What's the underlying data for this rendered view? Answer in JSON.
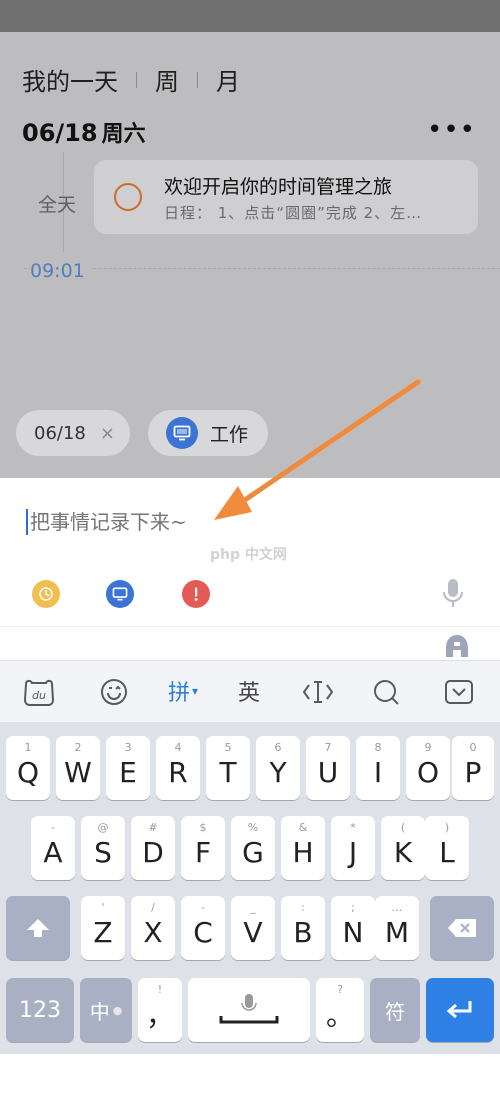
{
  "calendar": {
    "tabs": [
      "我的一天",
      "周",
      "月"
    ],
    "date": "06/18",
    "weekday": "周六",
    "more_label": "•••",
    "allday_label": "全天",
    "event": {
      "title": "欢迎开启你的时间管理之旅",
      "subtitle": "日程：  1、点击“圆圈”完成 2、左…"
    },
    "time_label": "09:01"
  },
  "chips": {
    "date": "06/18",
    "date_close": "×",
    "category": "工作"
  },
  "input": {
    "placeholder": "把事情记录下来~"
  },
  "watermark": "php 中文网",
  "toolbar": {
    "pinyin": "拼",
    "english": "英"
  },
  "keyboard": {
    "row1": [
      {
        "hint": "1",
        "key": "Q"
      },
      {
        "hint": "2",
        "key": "W"
      },
      {
        "hint": "3",
        "key": "E"
      },
      {
        "hint": "4",
        "key": "R"
      },
      {
        "hint": "5",
        "key": "T"
      },
      {
        "hint": "6",
        "key": "Y"
      },
      {
        "hint": "7",
        "key": "U"
      },
      {
        "hint": "8",
        "key": "I"
      },
      {
        "hint": "9",
        "key": "O"
      },
      {
        "hint": "0",
        "key": "P"
      }
    ],
    "row2": [
      {
        "hint": "-",
        "key": "A"
      },
      {
        "hint": "@",
        "key": "S"
      },
      {
        "hint": "#",
        "key": "D"
      },
      {
        "hint": "$",
        "key": "F"
      },
      {
        "hint": "%",
        "key": "G"
      },
      {
        "hint": "&",
        "key": "H"
      },
      {
        "hint": "*",
        "key": "J"
      },
      {
        "hint": "(",
        "key": "K"
      },
      {
        "hint": ")",
        "key": "L"
      }
    ],
    "row3": [
      {
        "hint": "'",
        "key": "Z"
      },
      {
        "hint": "/",
        "key": "X"
      },
      {
        "hint": "-",
        "key": "C"
      },
      {
        "hint": "_",
        "key": "V"
      },
      {
        "hint": ":",
        "key": "B"
      },
      {
        "hint": ";",
        "key": "N"
      },
      {
        "hint": "…",
        "key": "M"
      }
    ],
    "key_123": "123",
    "key_zhong": "中",
    "key_comma_hint": "!",
    "key_comma": "，",
    "key_period_hint": "?",
    "key_period": "。",
    "key_symbol": "符"
  },
  "colors": {
    "accent_blue": "#2f80e4",
    "event_circle": "#cd6b2e",
    "time_blue": "#4f7fbf",
    "clock_yellow": "#f1be4f",
    "category_blue": "#3b74d2",
    "priority_red": "#e45a57",
    "arrow_orange": "#f08a3c"
  },
  "icons": {
    "clock": "clock-icon",
    "category": "monitor-icon",
    "priority": "exclamation-icon",
    "mic": "microphone-icon",
    "voice": "voice-a-icon",
    "du": "du-bear-icon",
    "emoji": "smiley-icon",
    "cursor": "cursor-icon",
    "search": "search-icon",
    "collapse": "collapse-keyboard-icon",
    "shift": "shift-icon",
    "delete": "backspace-icon",
    "enter": "enter-icon"
  }
}
